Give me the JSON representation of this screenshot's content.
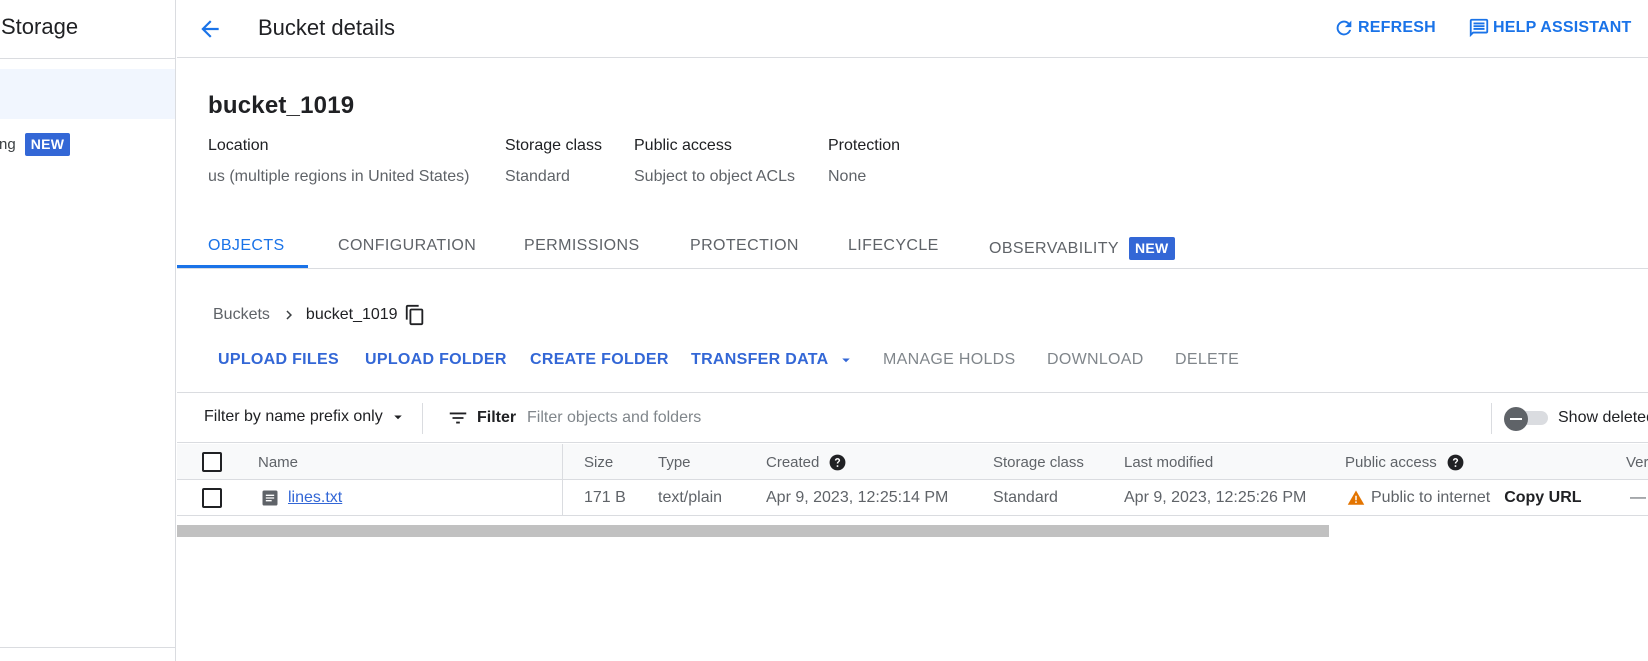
{
  "sidebar": {
    "title": "Storage",
    "item_label": "ng",
    "item_badge": "NEW"
  },
  "header": {
    "title": "Bucket details",
    "refresh_label": "REFRESH",
    "help_label": "HELP ASSISTANT"
  },
  "bucket": {
    "name": "bucket_1019",
    "location_label": "Location",
    "location_value": "us (multiple regions in United States)",
    "storage_class_label": "Storage class",
    "storage_class_value": "Standard",
    "public_access_label": "Public access",
    "public_access_value": "Subject to object ACLs",
    "protection_label": "Protection",
    "protection_value": "None"
  },
  "tabs": [
    {
      "label": "OBJECTS",
      "active": true
    },
    {
      "label": "CONFIGURATION"
    },
    {
      "label": "PERMISSIONS"
    },
    {
      "label": "PROTECTION"
    },
    {
      "label": "LIFECYCLE"
    },
    {
      "label": "OBSERVABILITY",
      "badge": "NEW"
    }
  ],
  "breadcrumb": {
    "root": "Buckets",
    "current": "bucket_1019"
  },
  "actions": {
    "upload_files": "UPLOAD FILES",
    "upload_folder": "UPLOAD FOLDER",
    "create_folder": "CREATE FOLDER",
    "transfer_data": "TRANSFER DATA",
    "manage_holds": "MANAGE HOLDS",
    "download": "DOWNLOAD",
    "delete": "DELETE"
  },
  "filter": {
    "mode": "Filter by name prefix only",
    "chip_label": "Filter",
    "placeholder": "Filter objects and folders",
    "show_deleted_label": "Show deleted data",
    "show_deleted_on": false
  },
  "table": {
    "columns": {
      "name": "Name",
      "size": "Size",
      "type": "Type",
      "created": "Created",
      "storage_class": "Storage class",
      "last_modified": "Last modified",
      "public_access": "Public access",
      "version": "Version history"
    },
    "rows": [
      {
        "name": "lines.txt",
        "size": "171 B",
        "type": "text/plain",
        "created": "Apr 9, 2023, 12:25:14 PM",
        "storage_class": "Standard",
        "last_modified": "Apr 9, 2023, 12:25:26 PM",
        "public_access": "Public to internet",
        "copy_url": "Copy URL",
        "version": "—"
      }
    ]
  },
  "colors": {
    "accent": "#1a73e8",
    "badge": "#3367d6",
    "warning": "#e37400"
  }
}
